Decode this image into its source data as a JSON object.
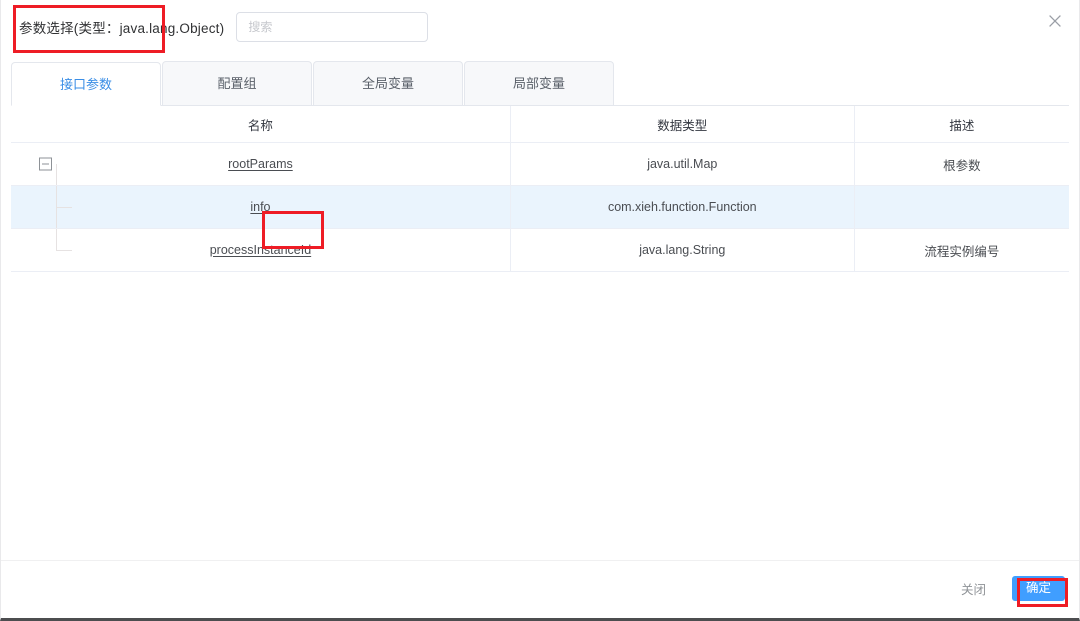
{
  "dialog": {
    "title": "参数选择(类型：java.lang.Object)",
    "close_icon": "close-icon"
  },
  "search": {
    "placeholder": "搜索",
    "value": ""
  },
  "tabs": [
    {
      "label": "接口参数",
      "active": true
    },
    {
      "label": "配置组",
      "active": false
    },
    {
      "label": "全局变量",
      "active": false
    },
    {
      "label": "局部变量",
      "active": false
    }
  ],
  "table": {
    "columns": [
      "名称",
      "数据类型",
      "描述"
    ],
    "rows": [
      {
        "name": "rootParams",
        "type": "java.util.Map",
        "desc": "根参数",
        "level": 0,
        "expanded": true,
        "highlighted": false
      },
      {
        "name": "info",
        "type": "com.xieh.function.Function",
        "desc": "",
        "level": 1,
        "expanded": false,
        "highlighted": true
      },
      {
        "name": "processInstanceId",
        "type": "java.lang.String",
        "desc": "流程实例编号",
        "level": 1,
        "expanded": false,
        "highlighted": false
      }
    ]
  },
  "footer": {
    "close_label": "关闭",
    "confirm_label": "确定"
  },
  "colors": {
    "accent": "#409eff",
    "active_tab_text": "#3a8ee6",
    "row_highlight": "#eaf4fd",
    "annotation": "#ee1c25",
    "border": "#ebeef5"
  }
}
